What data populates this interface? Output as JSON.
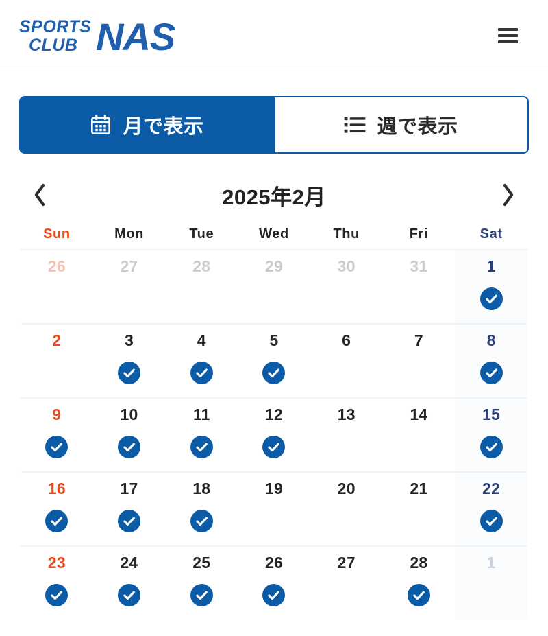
{
  "header": {
    "logo": {
      "line1": "SPORTS",
      "line2": "CLUB",
      "brand": "NAS",
      "color": "#1f5fae"
    },
    "menu_label": "menu"
  },
  "tabs": [
    {
      "label": "月で表示",
      "icon": "calendar-icon",
      "active": true
    },
    {
      "label": "週で表示",
      "icon": "list-icon",
      "active": false
    }
  ],
  "month_nav": {
    "prev_label": "‹",
    "next_label": "›",
    "current_month": "2025年2月"
  },
  "calendar": {
    "weekdays": [
      {
        "label": "Sun",
        "type": "sun"
      },
      {
        "label": "Mon",
        "type": "wk"
      },
      {
        "label": "Tue",
        "type": "wk"
      },
      {
        "label": "Wed",
        "type": "wk"
      },
      {
        "label": "Thu",
        "type": "wk"
      },
      {
        "label": "Fri",
        "type": "wk"
      },
      {
        "label": "Sat",
        "type": "sat"
      }
    ],
    "weeks": [
      [
        {
          "day": "26",
          "type": "out-sun",
          "check": false
        },
        {
          "day": "27",
          "type": "out-wk",
          "check": false
        },
        {
          "day": "28",
          "type": "out-wk",
          "check": false
        },
        {
          "day": "29",
          "type": "out-wk",
          "check": false
        },
        {
          "day": "30",
          "type": "out-wk",
          "check": false
        },
        {
          "day": "31",
          "type": "out-wk",
          "check": false
        },
        {
          "day": "1",
          "type": "sat",
          "check": true
        }
      ],
      [
        {
          "day": "2",
          "type": "sun",
          "check": false
        },
        {
          "day": "3",
          "type": "wk",
          "check": true
        },
        {
          "day": "4",
          "type": "wk",
          "check": true
        },
        {
          "day": "5",
          "type": "wk",
          "check": true
        },
        {
          "day": "6",
          "type": "wk",
          "check": false
        },
        {
          "day": "7",
          "type": "wk",
          "check": false
        },
        {
          "day": "8",
          "type": "sat",
          "check": true
        }
      ],
      [
        {
          "day": "9",
          "type": "sun",
          "check": true
        },
        {
          "day": "10",
          "type": "wk",
          "check": true
        },
        {
          "day": "11",
          "type": "wk",
          "check": true
        },
        {
          "day": "12",
          "type": "wk",
          "check": true
        },
        {
          "day": "13",
          "type": "wk",
          "check": false
        },
        {
          "day": "14",
          "type": "wk",
          "check": false
        },
        {
          "day": "15",
          "type": "sat",
          "check": true
        }
      ],
      [
        {
          "day": "16",
          "type": "sun",
          "check": true
        },
        {
          "day": "17",
          "type": "wk",
          "check": true
        },
        {
          "day": "18",
          "type": "wk",
          "check": true
        },
        {
          "day": "19",
          "type": "wk",
          "check": false
        },
        {
          "day": "20",
          "type": "wk",
          "check": false
        },
        {
          "day": "21",
          "type": "wk",
          "check": false
        },
        {
          "day": "22",
          "type": "sat",
          "check": true
        }
      ],
      [
        {
          "day": "23",
          "type": "sun",
          "check": true
        },
        {
          "day": "24",
          "type": "wk",
          "check": true
        },
        {
          "day": "25",
          "type": "wk",
          "check": true
        },
        {
          "day": "26",
          "type": "wk",
          "check": true
        },
        {
          "day": "27",
          "type": "wk",
          "check": false
        },
        {
          "day": "28",
          "type": "wk",
          "check": true
        },
        {
          "day": "1",
          "type": "out-sat",
          "check": false
        }
      ]
    ]
  },
  "colors": {
    "brand_blue": "#0b5ba6",
    "logo_blue": "#1f5fae",
    "sunday_red": "#e8491d",
    "saturday_blue": "#2b3f7a",
    "divider": "#eff3f8"
  }
}
